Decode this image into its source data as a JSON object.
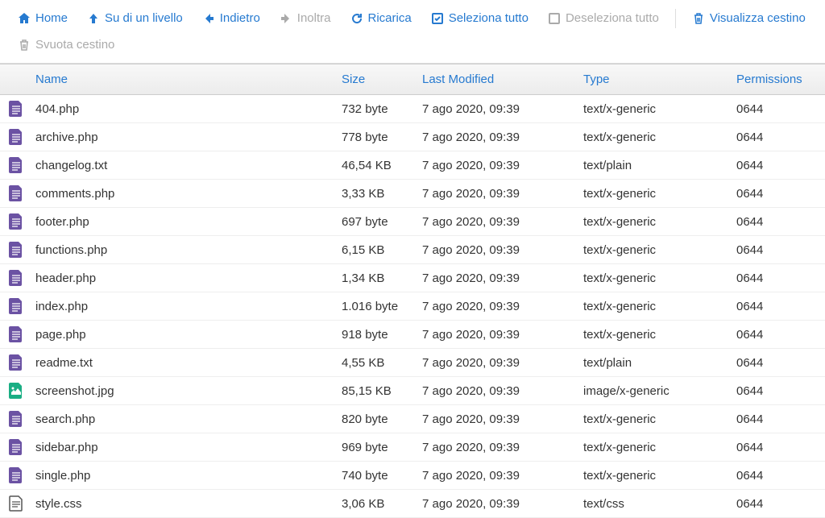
{
  "toolbar": {
    "home": "Home",
    "up": "Su di un livello",
    "back": "Indietro",
    "forward": "Inoltra",
    "reload": "Ricarica",
    "select_all": "Seleziona tutto",
    "deselect_all": "Deseleziona tutto",
    "view_trash": "Visualizza cestino",
    "empty_trash": "Svuota cestino"
  },
  "headers": {
    "name": "Name",
    "size": "Size",
    "modified": "Last Modified",
    "type": "Type",
    "permissions": "Permissions"
  },
  "colors": {
    "link": "#267ad0",
    "file_doc": "#6b52a3",
    "file_image": "#1aae84"
  },
  "files": [
    {
      "name": "404.php",
      "size": "732 byte",
      "modified": "7 ago 2020, 09:39",
      "type": "text/x-generic",
      "perm": "0644",
      "icon": "doc"
    },
    {
      "name": "archive.php",
      "size": "778 byte",
      "modified": "7 ago 2020, 09:39",
      "type": "text/x-generic",
      "perm": "0644",
      "icon": "doc"
    },
    {
      "name": "changelog.txt",
      "size": "46,54 KB",
      "modified": "7 ago 2020, 09:39",
      "type": "text/plain",
      "perm": "0644",
      "icon": "doc"
    },
    {
      "name": "comments.php",
      "size": "3,33 KB",
      "modified": "7 ago 2020, 09:39",
      "type": "text/x-generic",
      "perm": "0644",
      "icon": "doc"
    },
    {
      "name": "footer.php",
      "size": "697 byte",
      "modified": "7 ago 2020, 09:39",
      "type": "text/x-generic",
      "perm": "0644",
      "icon": "doc"
    },
    {
      "name": "functions.php",
      "size": "6,15 KB",
      "modified": "7 ago 2020, 09:39",
      "type": "text/x-generic",
      "perm": "0644",
      "icon": "doc"
    },
    {
      "name": "header.php",
      "size": "1,34 KB",
      "modified": "7 ago 2020, 09:39",
      "type": "text/x-generic",
      "perm": "0644",
      "icon": "doc"
    },
    {
      "name": "index.php",
      "size": "1.016 byte",
      "modified": "7 ago 2020, 09:39",
      "type": "text/x-generic",
      "perm": "0644",
      "icon": "doc"
    },
    {
      "name": "page.php",
      "size": "918 byte",
      "modified": "7 ago 2020, 09:39",
      "type": "text/x-generic",
      "perm": "0644",
      "icon": "doc"
    },
    {
      "name": "readme.txt",
      "size": "4,55 KB",
      "modified": "7 ago 2020, 09:39",
      "type": "text/plain",
      "perm": "0644",
      "icon": "doc"
    },
    {
      "name": "screenshot.jpg",
      "size": "85,15 KB",
      "modified": "7 ago 2020, 09:39",
      "type": "image/x-generic",
      "perm": "0644",
      "icon": "image"
    },
    {
      "name": "search.php",
      "size": "820 byte",
      "modified": "7 ago 2020, 09:39",
      "type": "text/x-generic",
      "perm": "0644",
      "icon": "doc"
    },
    {
      "name": "sidebar.php",
      "size": "969 byte",
      "modified": "7 ago 2020, 09:39",
      "type": "text/x-generic",
      "perm": "0644",
      "icon": "doc"
    },
    {
      "name": "single.php",
      "size": "740 byte",
      "modified": "7 ago 2020, 09:39",
      "type": "text/x-generic",
      "perm": "0644",
      "icon": "doc"
    },
    {
      "name": "style.css",
      "size": "3,06 KB",
      "modified": "7 ago 2020, 09:39",
      "type": "text/css",
      "perm": "0644",
      "icon": "css"
    }
  ]
}
